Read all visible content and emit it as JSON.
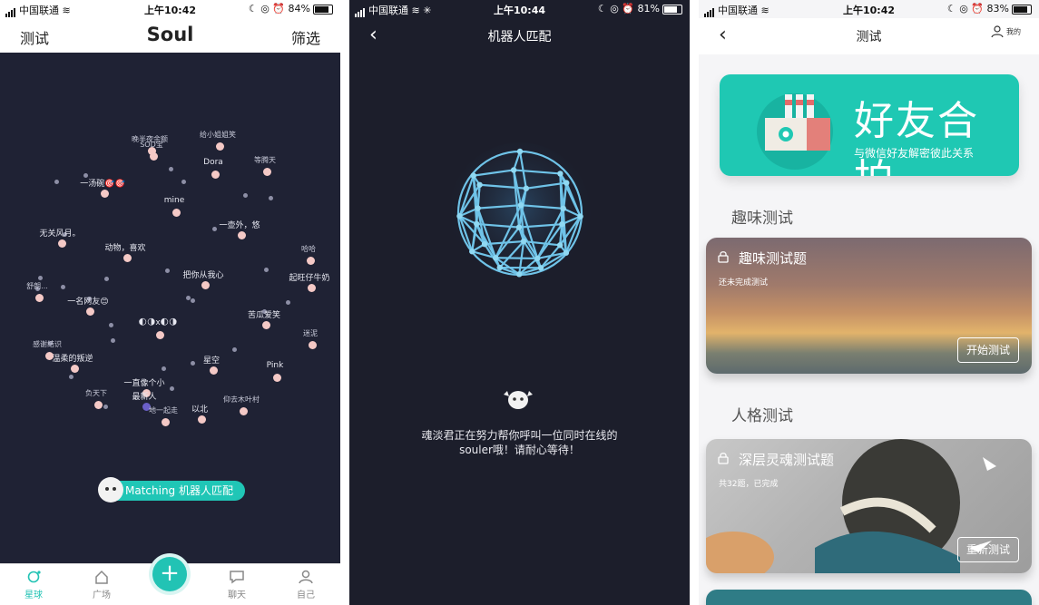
{
  "phone1": {
    "status": {
      "carrier": "中国联通",
      "time": "上午10:42",
      "battery": "84%"
    },
    "header": {
      "left": "测试",
      "title": "Soul",
      "right": "筛选"
    },
    "stars": [
      {
        "label": "晚半夜余额",
        "big": false
      },
      {
        "label": "SOD宝",
        "big": false
      },
      {
        "label": "给小姐姐笑",
        "big": false
      },
      {
        "label": "Dora",
        "big": true
      },
      {
        "label": "等腾天",
        "big": false
      },
      {
        "label": "一汤碗🎯🎯",
        "big": true
      },
      {
        "label": "mine",
        "big": true
      },
      {
        "label": "无关风月。",
        "big": true
      },
      {
        "label": "一壶外，悠",
        "big": true
      },
      {
        "label": "哈哈",
        "big": false
      },
      {
        "label": "动物，喜欢",
        "big": true
      },
      {
        "label": "把你从我心",
        "big": true
      },
      {
        "label": "起旺仔牛奶",
        "big": true
      },
      {
        "label": "一名网友😊",
        "big": true
      },
      {
        "label": "苦瓜爱笑",
        "big": true
      },
      {
        "label": "🌓🌗x🌓🌗",
        "big": true
      },
      {
        "label": "迷泥",
        "big": false
      },
      {
        "label": "感谢结识",
        "big": false
      },
      {
        "label": "温柔的叛逆",
        "big": true
      },
      {
        "label": "星空",
        "big": true
      },
      {
        "label": "Pink",
        "big": true
      },
      {
        "label": "一直像个小",
        "big": true
      },
      {
        "label": "最新人",
        "big": true
      },
      {
        "label": "以北",
        "big": true
      },
      {
        "label": "仰去木叶村",
        "big": false
      },
      {
        "label": "负天下",
        "big": false
      },
      {
        "label": "地一起走",
        "big": false
      },
      {
        "label": "舒朗...",
        "big": false
      }
    ],
    "match_label": "Matching 机器人匹配",
    "nav": [
      {
        "label": "星球"
      },
      {
        "label": "广场"
      },
      {
        "label": "聊天"
      },
      {
        "label": "自己"
      }
    ],
    "colors": {
      "accent": "#22c3b4",
      "bg": "#1f2234"
    }
  },
  "phone2": {
    "status": {
      "carrier": "中国联通",
      "time": "上午10:44",
      "battery": "81%"
    },
    "header": {
      "title": "机器人匹配"
    },
    "message_line1": "魂淡君正在努力帮你呼叫一位同时在线的",
    "message_line2": "souler哦！请耐心等待！"
  },
  "phone3": {
    "status": {
      "carrier": "中国联通",
      "time": "上午10:42",
      "battery": "83%"
    },
    "header": {
      "title": "测试",
      "icon_text": "我的"
    },
    "banner": {
      "title": "好友合拍",
      "subtitle": "与微信好友解密彼此关系"
    },
    "section1": "趣味测试",
    "card1": {
      "title": "趣味测试题",
      "subtitle": "还未完成测试",
      "button": "开始测试"
    },
    "section2": "人格测试",
    "card2": {
      "title": "深层灵魂测试题",
      "subtitle": "共32题，已完成",
      "button": "重新测试"
    }
  }
}
